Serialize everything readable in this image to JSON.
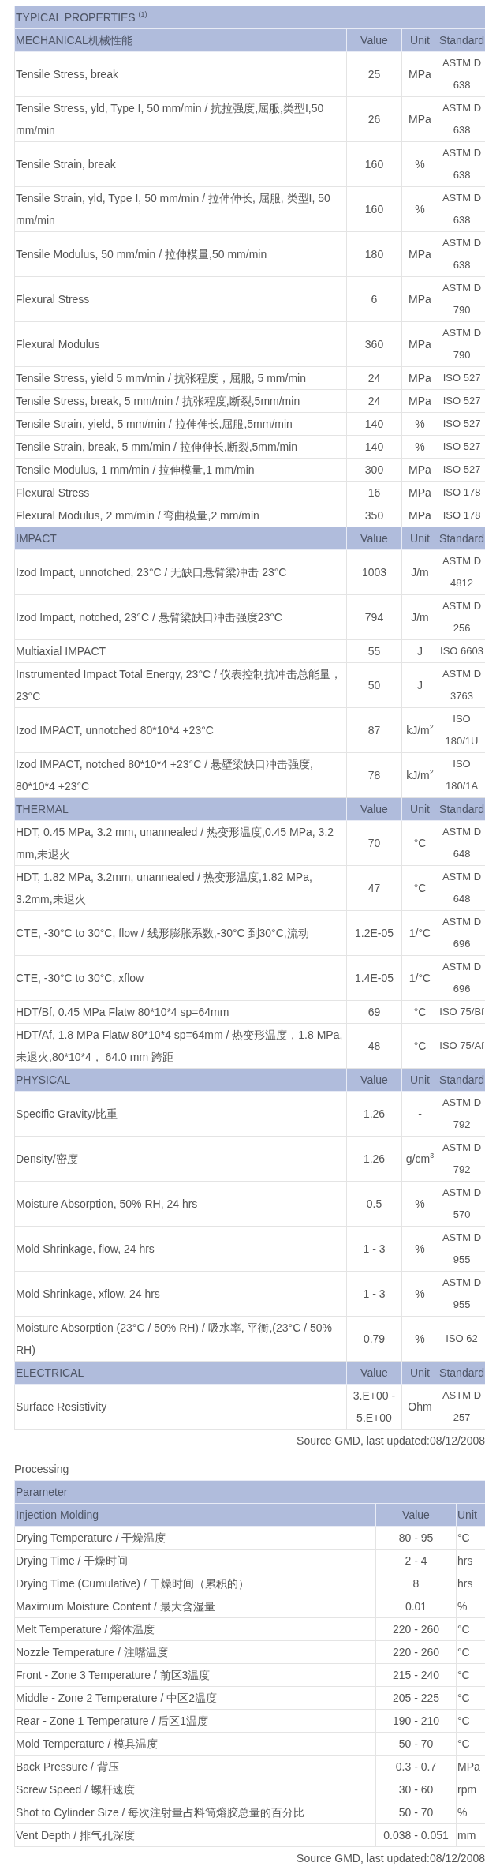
{
  "properties": {
    "title": "TYPICAL PROPERTIES $^{(1)}$",
    "sections": [
      {
        "name": "MECHANICAL机械性能",
        "headers": [
          "Value",
          "Unit",
          "Standard"
        ],
        "rows": [
          {
            "property": "Tensile Stress, break",
            "value": "25",
            "unit": "MPa",
            "standard": "ASTM D 638"
          },
          {
            "property": "Tensile Stress, yld, Type I, 50 mm/min / 抗拉强度,屈服,类型I,50 mm/min",
            "value": "26",
            "unit": "MPa",
            "standard": "ASTM D 638"
          },
          {
            "property": "Tensile Strain, break",
            "value": "160",
            "unit": "%",
            "standard": "ASTM D 638"
          },
          {
            "property": "Tensile Strain, yld, Type I, 50 mm/min / 拉伸伸长, 屈服, 类型I, 50 mm/min",
            "value": "160",
            "unit": "%",
            "standard": "ASTM D 638"
          },
          {
            "property": "Tensile Modulus, 50 mm/min / 拉伸模量,50 mm/min",
            "value": "180",
            "unit": "MPa",
            "standard": "ASTM D 638"
          },
          {
            "property": "Flexural Stress",
            "value": "6",
            "unit": "MPa",
            "standard": "ASTM D 790"
          },
          {
            "property": "Flexural Modulus",
            "value": "360",
            "unit": "MPa",
            "standard": "ASTM D 790"
          },
          {
            "property": "Tensile Stress, yield 5 mm/min / 抗张程度，屈服, 5 mm/min",
            "value": "24",
            "unit": "MPa",
            "standard": "ISO 527"
          },
          {
            "property": "Tensile Stress, break, 5 mm/min / 抗张程度,断裂,5mm/min",
            "value": "24",
            "unit": "MPa",
            "standard": "ISO 527"
          },
          {
            "property": "Tensile Strain, yield, 5 mm/min / 拉伸伸长,屈服,5mm/min",
            "value": "140",
            "unit": "%",
            "standard": "ISO 527"
          },
          {
            "property": "Tensile Strain, break, 5 mm/min / 拉伸伸长,断裂,5mm/min",
            "value": "140",
            "unit": "%",
            "standard": "ISO 527"
          },
          {
            "property": "Tensile Modulus, 1 mm/min / 拉伸模量,1 mm/min",
            "value": "300",
            "unit": "MPa",
            "standard": "ISO 527"
          },
          {
            "property": "Flexural Stress",
            "value": "16",
            "unit": "MPa",
            "standard": "ISO 178"
          },
          {
            "property": "Flexural Modulus, 2 mm/min / 弯曲模量,2 mm/min",
            "value": "350",
            "unit": "MPa",
            "standard": "ISO 178"
          }
        ]
      },
      {
        "name": "IMPACT",
        "headers": [
          "Value",
          "Unit",
          "Standard"
        ],
        "rows": [
          {
            "property": "Izod Impact, unnotched, 23°C / 无缺口悬臂梁冲击 23°C",
            "value": "1003",
            "unit": "J/m",
            "standard": "ASTM D 4812"
          },
          {
            "property": "Izod Impact, notched, 23°C / 悬臂梁缺口冲击强度23°C",
            "value": "794",
            "unit": "J/m",
            "standard": "ASTM D 256"
          },
          {
            "property": "Multiaxial IMPACT",
            "value": "55",
            "unit": "J",
            "standard": "ISO 6603"
          },
          {
            "property": "Instrumented Impact Total Energy, 23°C / 仪表控制抗冲击总能量，23°C",
            "value": "50",
            "unit": "J",
            "standard": "ASTM D 3763"
          },
          {
            "property": "Izod IMPACT, unnotched 80*10*4 +23°C",
            "value": "87",
            "unit": "kJ/m$^{2}$",
            "standard": "ISO 180/1U"
          },
          {
            "property": "Izod IMPACT, notched 80*10*4 +23°C / 悬壁梁缺口冲击强度, 80*10*4 +23°C",
            "value": "78",
            "unit": "kJ/m$^{2}$",
            "standard": "ISO 180/1A"
          }
        ]
      },
      {
        "name": "THERMAL",
        "headers": [
          "Value",
          "Unit",
          "Standard"
        ],
        "rows": [
          {
            "property": "HDT, 0.45 MPa, 3.2 mm, unannealed / 热变形温度,0.45 MPa, 3.2 mm,未退火",
            "value": "70",
            "unit": "°C",
            "standard": "ASTM D 648"
          },
          {
            "property": "HDT, 1.82 MPa, 3.2mm, unannealed / 热变形温度,1.82 MPa, 3.2mm,未退火",
            "value": "47",
            "unit": "°C",
            "standard": "ASTM D 648"
          },
          {
            "property": "CTE, -30°C to 30°C, flow / 线形膨胀系数,-30°C 到30°C,流动",
            "value": "1.2E-05",
            "unit": "1/°C",
            "standard": "ASTM D 696"
          },
          {
            "property": "CTE, -30°C to 30°C, xflow",
            "value": "1.4E-05",
            "unit": "1/°C",
            "standard": "ASTM D 696"
          },
          {
            "property": "HDT/Bf, 0.45 MPa Flatw 80*10*4 sp=64mm",
            "value": "69",
            "unit": "°C",
            "standard": "ISO 75/Bf"
          },
          {
            "property": "HDT/Af, 1.8 MPa Flatw 80*10*4 sp=64mm / 热变形温度，1.8 MPa, 未退火,80*10*4， 64.0 mm 跨距",
            "value": "48",
            "unit": "°C",
            "standard": "ISO 75/Af"
          }
        ]
      },
      {
        "name": "PHYSICAL",
        "headers": [
          "Value",
          "Unit",
          "Standard"
        ],
        "rows": [
          {
            "property": "Specific Gravity/比重",
            "value": "1.26",
            "unit": "-",
            "standard": "ASTM D 792"
          },
          {
            "property": "Density/密度",
            "value": "1.26",
            "unit": "g/cm$^{3}$",
            "standard": "ASTM D 792"
          },
          {
            "property": "Moisture Absorption, 50% RH, 24 hrs",
            "value": "0.5",
            "unit": "%",
            "standard": "ASTM D 570"
          },
          {
            "property": "Mold Shrinkage, flow, 24 hrs",
            "value": "1 - 3",
            "unit": "%",
            "standard": "ASTM D 955"
          },
          {
            "property": "Mold Shrinkage, xflow, 24 hrs",
            "value": "1 - 3",
            "unit": "%",
            "standard": "ASTM D 955"
          },
          {
            "property": "Moisture Absorption (23°C / 50% RH) / 吸水率, 平衡,(23°C / 50% RH)",
            "value": "0.79",
            "unit": "%",
            "standard": "ISO 62"
          }
        ]
      },
      {
        "name": "ELECTRICAL",
        "headers": [
          "Value",
          "Unit",
          "Standard"
        ],
        "rows": [
          {
            "property": "Surface Resistivity",
            "value": "3.E+00 - 5.E+00",
            "unit": "Ohm",
            "standard": "ASTM D 257"
          }
        ]
      }
    ],
    "source_note": "Source GMD, last updated:08/12/2008"
  },
  "processing": {
    "title": "Processing",
    "header": "Parameter",
    "section": "Injection Molding",
    "headers": [
      "Value",
      "Unit"
    ],
    "rows": [
      {
        "parameter": "Drying Temperature / 干燥温度",
        "value": "80 - 95",
        "unit": "°C"
      },
      {
        "parameter": "Drying Time / 干燥时间",
        "value": "2 - 4",
        "unit": "hrs"
      },
      {
        "parameter": "Drying Time (Cumulative) / 干燥时间（累积的）",
        "value": "8",
        "unit": "hrs"
      },
      {
        "parameter": "Maximum Moisture Content / 最大含湿量",
        "value": "0.01",
        "unit": "%"
      },
      {
        "parameter": "Melt Temperature / 熔体温度",
        "value": "220 - 260",
        "unit": "°C"
      },
      {
        "parameter": "Nozzle Temperature / 注嘴温度",
        "value": "220 - 260",
        "unit": "°C"
      },
      {
        "parameter": "Front - Zone 3 Temperature / 前区3温度",
        "value": "215 - 240",
        "unit": "°C"
      },
      {
        "parameter": "Middle - Zone 2 Temperature / 中区2温度",
        "value": "205 - 225",
        "unit": "°C"
      },
      {
        "parameter": "Rear - Zone 1 Temperature / 后区1温度",
        "value": "190 - 210",
        "unit": "°C"
      },
      {
        "parameter": "Mold Temperature / 模具温度",
        "value": "50 - 70",
        "unit": "°C"
      },
      {
        "parameter": "Back Pressure / 背压",
        "value": "0.3 - 0.7",
        "unit": "MPa"
      },
      {
        "parameter": "Screw Speed / 螺杆速度",
        "value": "30 - 60",
        "unit": "rpm"
      },
      {
        "parameter": "Shot to Cylinder Size / 每次注射量占料筒熔胶总量的百分比",
        "value": "50 - 70",
        "unit": "%"
      },
      {
        "parameter": "Vent Depth / 排气孔深度",
        "value": "0.038 - 0.051",
        "unit": "mm"
      }
    ],
    "source_note": "Source GMD, last updated:08/12/2008"
  }
}
